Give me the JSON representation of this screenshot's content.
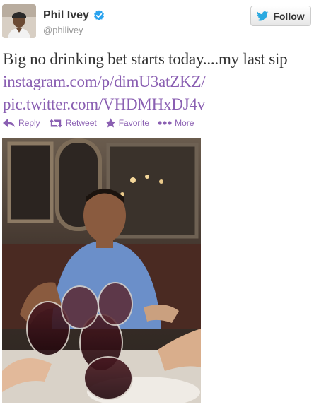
{
  "user": {
    "display_name": "Phil Ivey",
    "handle": "@philivey"
  },
  "follow": {
    "label": "Follow"
  },
  "tweet": {
    "text_prefix": "Big no drinking bet starts today....my last sip ",
    "link1": "instagram.com/p/dimU3atZKZ/",
    "link2": "pic.twitter.com/VHDMHxDJ4v"
  },
  "actions": {
    "reply": "Reply",
    "retweet": "Retweet",
    "favorite": "Favorite",
    "more": "More"
  },
  "colors": {
    "link": "#8a5fb2",
    "verified": "#2aa3ef",
    "twitter_bird": "#2aa9e0"
  },
  "icons": {
    "verified": "verified-badge-icon",
    "bird": "twitter-bird-icon",
    "reply": "reply-arrow-icon",
    "retweet": "retweet-icon",
    "favorite": "star-icon",
    "more": "dots-icon"
  }
}
